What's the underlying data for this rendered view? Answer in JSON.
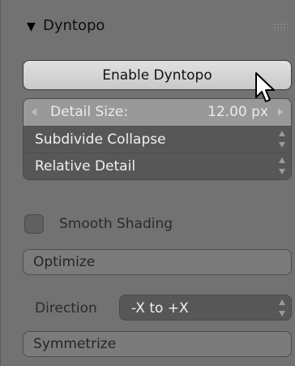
{
  "panel": {
    "title": "Dyntopo",
    "collapse_glyph": "▼"
  },
  "enable_button": {
    "label": "Enable Dyntopo"
  },
  "detail_size": {
    "label": "Detail Size:",
    "value": "12.00 px"
  },
  "menus": {
    "subdivide": "Subdivide Collapse",
    "detail_mode": "Relative Detail"
  },
  "smooth_shading": {
    "label": "Smooth Shading",
    "checked": false
  },
  "optimize_button": {
    "label": "Optimize"
  },
  "direction": {
    "label": "Direction",
    "value": "-X to +X"
  },
  "symmetrize_button": {
    "label": "Symmetrize"
  },
  "icons": {
    "collapse": "collapse-triangle-icon",
    "grip": "drag-grip-icon",
    "cursor": "mouse-pointer-icon",
    "updown": "updown-arrows-icon"
  },
  "colors": {
    "panel_bg": "#727272",
    "menu_bg": "#575757",
    "field_bg": "#999999",
    "button_bg": "#d8d8d8"
  }
}
